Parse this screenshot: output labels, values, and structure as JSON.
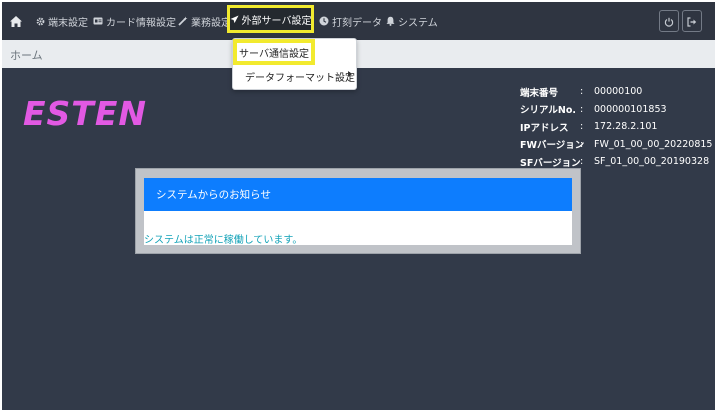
{
  "nav": {
    "home_icon": "home-icon",
    "items": [
      {
        "label": "端末設定",
        "icon": "gear-icon"
      },
      {
        "label": "カード情報設定",
        "icon": "id-card-icon"
      },
      {
        "label": "業務設定",
        "icon": "magic-wand-icon"
      },
      {
        "label": "外部サーバ設定",
        "icon": "paper-plane-icon"
      },
      {
        "label": "打刻データ",
        "icon": "clock-icon"
      },
      {
        "label": "システム",
        "icon": "bell-icon"
      }
    ],
    "right_buttons": [
      {
        "icon": "power-icon"
      },
      {
        "icon": "logout-icon"
      }
    ]
  },
  "breadcrumb": {
    "home": "ホーム"
  },
  "dropdown": {
    "items": [
      {
        "label": "サーバ通信設定"
      },
      {
        "label": "データフォーマット設定"
      }
    ]
  },
  "logo": {
    "text": "ESTEN"
  },
  "device_info": [
    {
      "label": "端末番号",
      "value": "00000100"
    },
    {
      "label": "シリアルNo.",
      "value": "000000101853"
    },
    {
      "label": "IPアドレス",
      "value": "172.28.2.101"
    },
    {
      "label": "FWバージョン",
      "value": "FW_01_00_00_20220815"
    },
    {
      "label": "SFバージョン",
      "value": "SF_01_00_00_20190328"
    }
  ],
  "info_separator": ":",
  "notice": {
    "title": "システムからのお知らせ",
    "message": "システムは正常に稼働しています。"
  },
  "colors": {
    "navbar": "#2f3541",
    "background": "#323a49",
    "highlight": "#f2ea2e",
    "logo": "#e259e3",
    "notice_header": "#0d7dfe",
    "notice_text": "#14a3b8"
  }
}
